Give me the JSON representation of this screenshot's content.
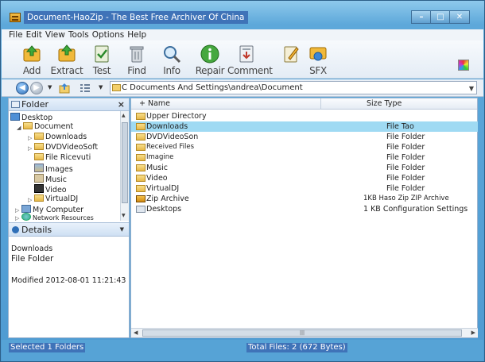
{
  "window": {
    "title": "Document-HaoZip - The Best Free Archiver Of China",
    "minimize": "–",
    "maximize": "□",
    "close": "✕"
  },
  "menu": [
    "File",
    "Edit",
    "View",
    "Tools",
    "Options",
    "Help"
  ],
  "toolbar": [
    {
      "label": "Add",
      "icon": "add-icon"
    },
    {
      "label": "Extract",
      "icon": "extract-icon"
    },
    {
      "label": "Test",
      "icon": "test-icon"
    },
    {
      "label": "Find",
      "icon": "find-icon"
    },
    {
      "label": "Info",
      "icon": "info-icon"
    },
    {
      "label": "Repair",
      "icon": "repair-icon"
    },
    {
      "label": "Comment",
      "icon": "comment-icon"
    },
    {
      "label": "SFX",
      "icon": "sfx-icon"
    }
  ],
  "address": {
    "drive": "C",
    "path": "Documents And Settings\\andrea\\Document"
  },
  "folder_pane": {
    "title": "Folder",
    "close": "×",
    "tree": [
      {
        "label": "Desktop",
        "kind": "desktop"
      },
      {
        "label": "Document",
        "kind": "folder"
      },
      {
        "label": "Downloads",
        "kind": "folder"
      },
      {
        "label": "DVDVideoSoft",
        "kind": "folder"
      },
      {
        "label": "File Ricevuti",
        "kind": "folder"
      },
      {
        "label": "Images",
        "kind": "images"
      },
      {
        "label": "Music",
        "kind": "music"
      },
      {
        "label": "Video",
        "kind": "video"
      },
      {
        "label": "VirtualDJ",
        "kind": "folder"
      },
      {
        "label": "My Computer",
        "kind": "pc"
      },
      {
        "label": "Network Resources",
        "kind": "net"
      }
    ]
  },
  "details": {
    "title": "Details",
    "name": "Downloads",
    "type": "File Folder",
    "modified": "Modified 2012-08-01 11:21:43"
  },
  "columns": {
    "name": "Name",
    "size_type": "Size Type"
  },
  "files": [
    {
      "name": "Upper Directory",
      "size_type": "",
      "kind": "up"
    },
    {
      "name": "Downloads",
      "size_type": "File Tao",
      "kind": "folder",
      "selected": true
    },
    {
      "name": "DVDVideoSon",
      "size_type": "File Folder",
      "kind": "folder"
    },
    {
      "name": "Received Files",
      "size_type": "File Folder",
      "kind": "folder"
    },
    {
      "name": "Imagine",
      "size_type": "File Folder",
      "kind": "folder"
    },
    {
      "name": "Music",
      "size_type": "File Folder",
      "kind": "folder"
    },
    {
      "name": "Video",
      "size_type": "File Folder",
      "kind": "folder"
    },
    {
      "name": "VirtualDJ",
      "size_type": "File Folder",
      "kind": "folder"
    },
    {
      "name": "Zip Archive",
      "size_type": "1KB Haso Zip ZIP Archive",
      "kind": "zip"
    },
    {
      "name": "Desktops",
      "size_type": "1 KB Configuration Settings",
      "kind": "cfg"
    }
  ],
  "status": {
    "left": "Selected 1 Folders",
    "middle": "Total Files: 2 (672 Bytes)"
  },
  "colors": {
    "selection": "#9fdaf3",
    "title_highlight": "#3f73b8",
    "frame": "#4f9bd2"
  }
}
